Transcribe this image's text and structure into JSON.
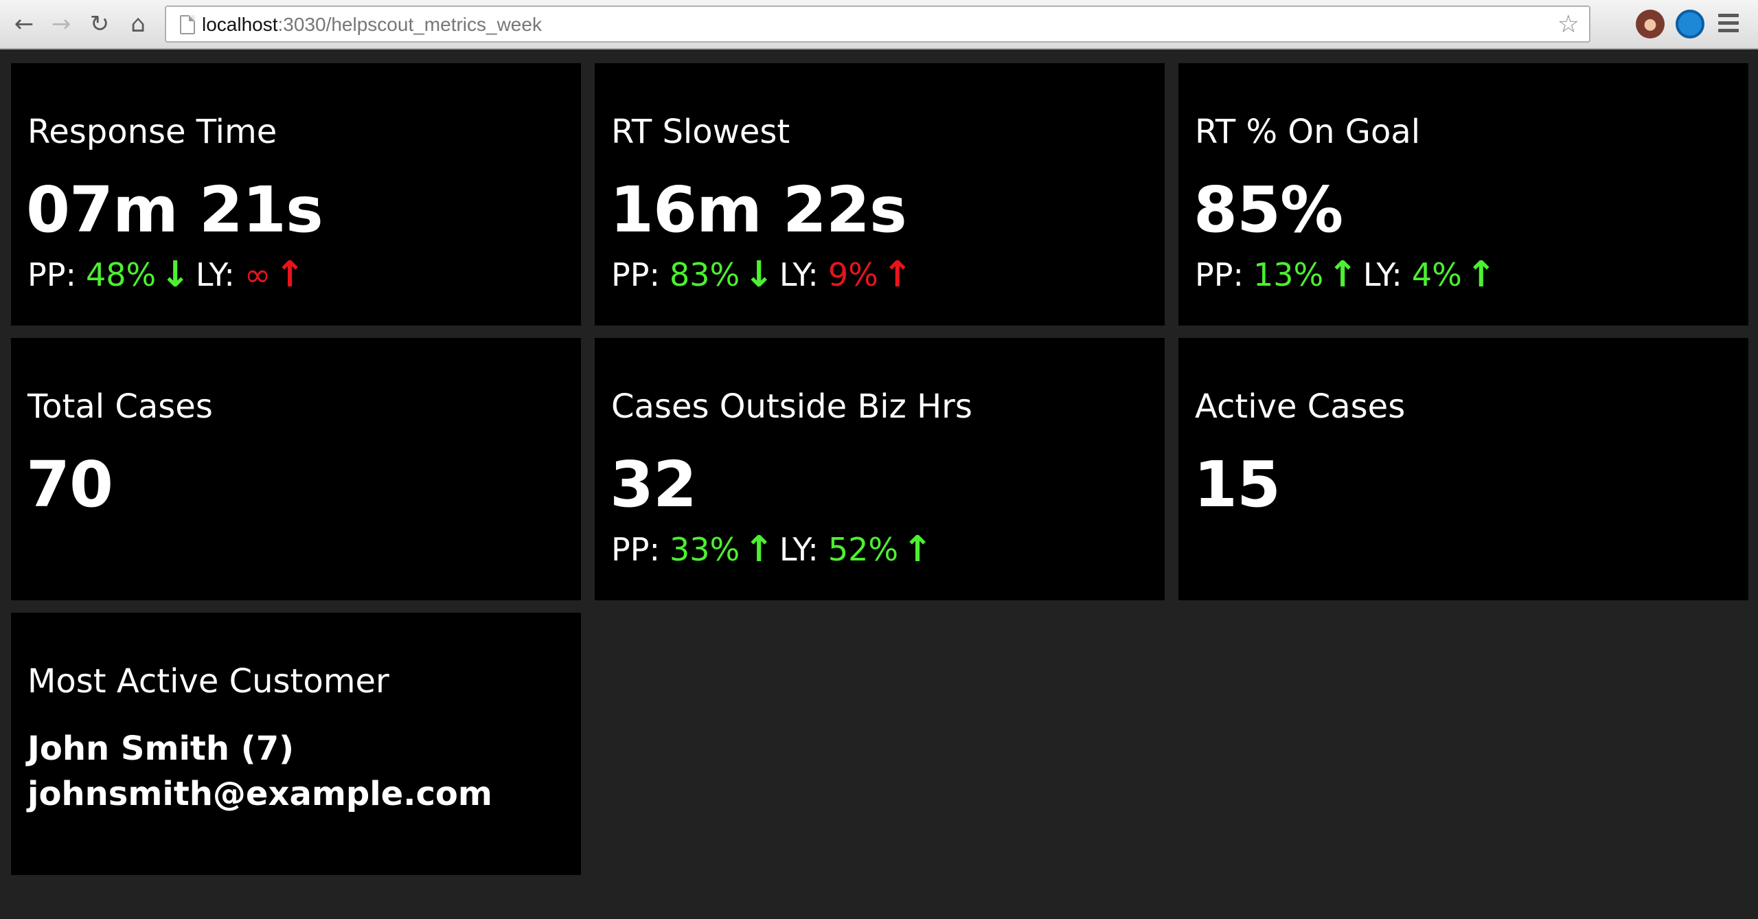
{
  "browser": {
    "url_host": "localhost",
    "url_rest": ":3030/helpscout_metrics_week",
    "back_icon": "←",
    "forward_icon": "→",
    "reload_icon": "↻",
    "home_icon": "⌂",
    "star_icon": "☆"
  },
  "tiles": {
    "response_time": {
      "title": "Response Time",
      "value": "07m 21s",
      "pp_label": "PP:",
      "pp_value": "48%",
      "pp_arrow": "↓",
      "ly_label": "LY:",
      "ly_value": "∞",
      "ly_arrow": "↑"
    },
    "rt_slowest": {
      "title": "RT Slowest",
      "value": "16m 22s",
      "pp_label": "PP:",
      "pp_value": "83%",
      "pp_arrow": "↓",
      "ly_label": "LY:",
      "ly_value": "9%",
      "ly_arrow": "↑"
    },
    "rt_on_goal": {
      "title": "RT % On Goal",
      "value": "85%",
      "pp_label": "PP:",
      "pp_value": "13%",
      "pp_arrow": "↑",
      "ly_label": "LY:",
      "ly_value": "4%",
      "ly_arrow": "↑"
    },
    "total_cases": {
      "title": "Total Cases",
      "value": "70"
    },
    "cases_outside": {
      "title": "Cases Outside Biz Hrs",
      "value": "32",
      "pp_label": "PP:",
      "pp_value": "33%",
      "pp_arrow": "↑",
      "ly_label": "LY:",
      "ly_value": "52%",
      "ly_arrow": "↑"
    },
    "active_cases": {
      "title": "Active Cases",
      "value": "15"
    },
    "most_active_customer": {
      "title": "Most Active Customer",
      "name": "John Smith (7)",
      "email": "johnsmith@example.com"
    }
  },
  "colors": {
    "background": "#222222",
    "tile": "#000000",
    "good": "#4cf030",
    "bad": "#e8141c"
  }
}
